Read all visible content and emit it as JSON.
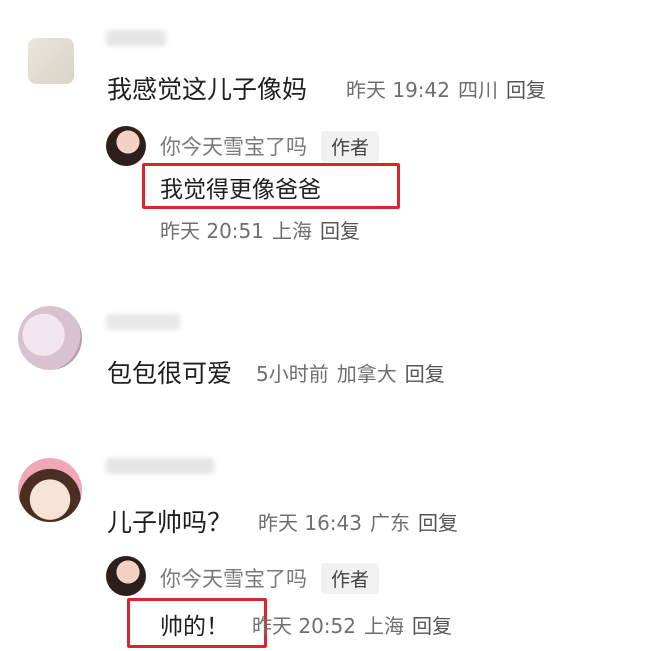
{
  "comments": [
    {
      "text": "我感觉这儿子像妈",
      "time": "昨天 19:42",
      "location": "四川",
      "reply_label": "回复",
      "reply": {
        "user": "你今天雪宝了吗",
        "badge": "作者",
        "text": "我觉得更像爸爸",
        "time": "昨天 20:51",
        "location": "上海",
        "reply_label": "回复"
      }
    },
    {
      "text": "包包很可爱",
      "time": "5小时前",
      "location": "加拿大",
      "reply_label": "回复"
    },
    {
      "text": "儿子帅吗？",
      "time": "昨天 16:43",
      "location": "广东",
      "reply_label": "回复",
      "reply": {
        "user": "你今天雪宝了吗",
        "badge": "作者",
        "text": "帅的！",
        "time": "昨天 20:52",
        "location": "上海",
        "reply_label": "回复"
      }
    }
  ],
  "colors": {
    "highlight_box": "#d9262b",
    "meta_text": "#6f6f6f"
  }
}
